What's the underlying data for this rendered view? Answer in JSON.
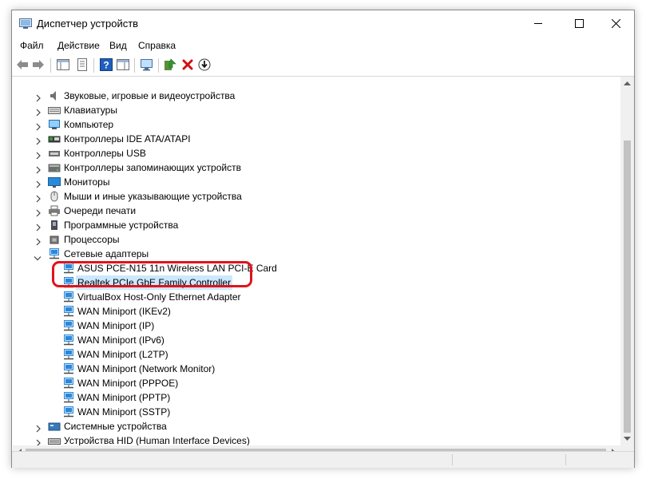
{
  "window": {
    "title": "Диспетчер устройств"
  },
  "menu": {
    "file": "Файл",
    "action": "Действие",
    "view": "Вид",
    "help": "Справка"
  },
  "tree": {
    "top_items": [
      {
        "label": "Звуковые, игровые и видеоустройства",
        "icon": "sound-icon"
      },
      {
        "label": "Клавиатуры",
        "icon": "keyboard-icon"
      },
      {
        "label": "Компьютер",
        "icon": "computer-icon"
      },
      {
        "label": "Контроллеры IDE ATA/ATAPI",
        "icon": "ide-controller-icon"
      },
      {
        "label": "Контроллеры USB",
        "icon": "usb-icon"
      },
      {
        "label": "Контроллеры запоминающих устройств",
        "icon": "storage-controller-icon"
      },
      {
        "label": "Мониторы",
        "icon": "monitor-icon"
      },
      {
        "label": "Мыши и иные указывающие устройства",
        "icon": "mouse-icon"
      },
      {
        "label": "Очереди печати",
        "icon": "printer-icon"
      },
      {
        "label": "Программные устройства",
        "icon": "software-device-icon"
      },
      {
        "label": "Процессоры",
        "icon": "processor-icon"
      }
    ],
    "network": {
      "label": "Сетевые адаптеры",
      "icon": "network-adapter-icon",
      "children": [
        "ASUS PCE-N15 11n Wireless LAN PCI-E Card",
        "Realtek PCIe GbE Family Controller",
        "VirtualBox Host-Only Ethernet Adapter",
        "WAN Miniport (IKEv2)",
        "WAN Miniport (IP)",
        "WAN Miniport (IPv6)",
        "WAN Miniport (L2TP)",
        "WAN Miniport (Network Monitor)",
        "WAN Miniport (PPPOE)",
        "WAN Miniport (PPTP)",
        "WAN Miniport (SSTP)"
      ],
      "selected_index": 1
    },
    "bottom_items": [
      {
        "label": "Системные устройства",
        "icon": "system-device-icon"
      },
      {
        "label": "Устройства HID (Human Interface Devices)",
        "icon": "hid-icon"
      }
    ]
  },
  "colors": {
    "highlight": "#e0131b",
    "selection": "#cce8ff",
    "network_icon": "#2e86d6"
  }
}
